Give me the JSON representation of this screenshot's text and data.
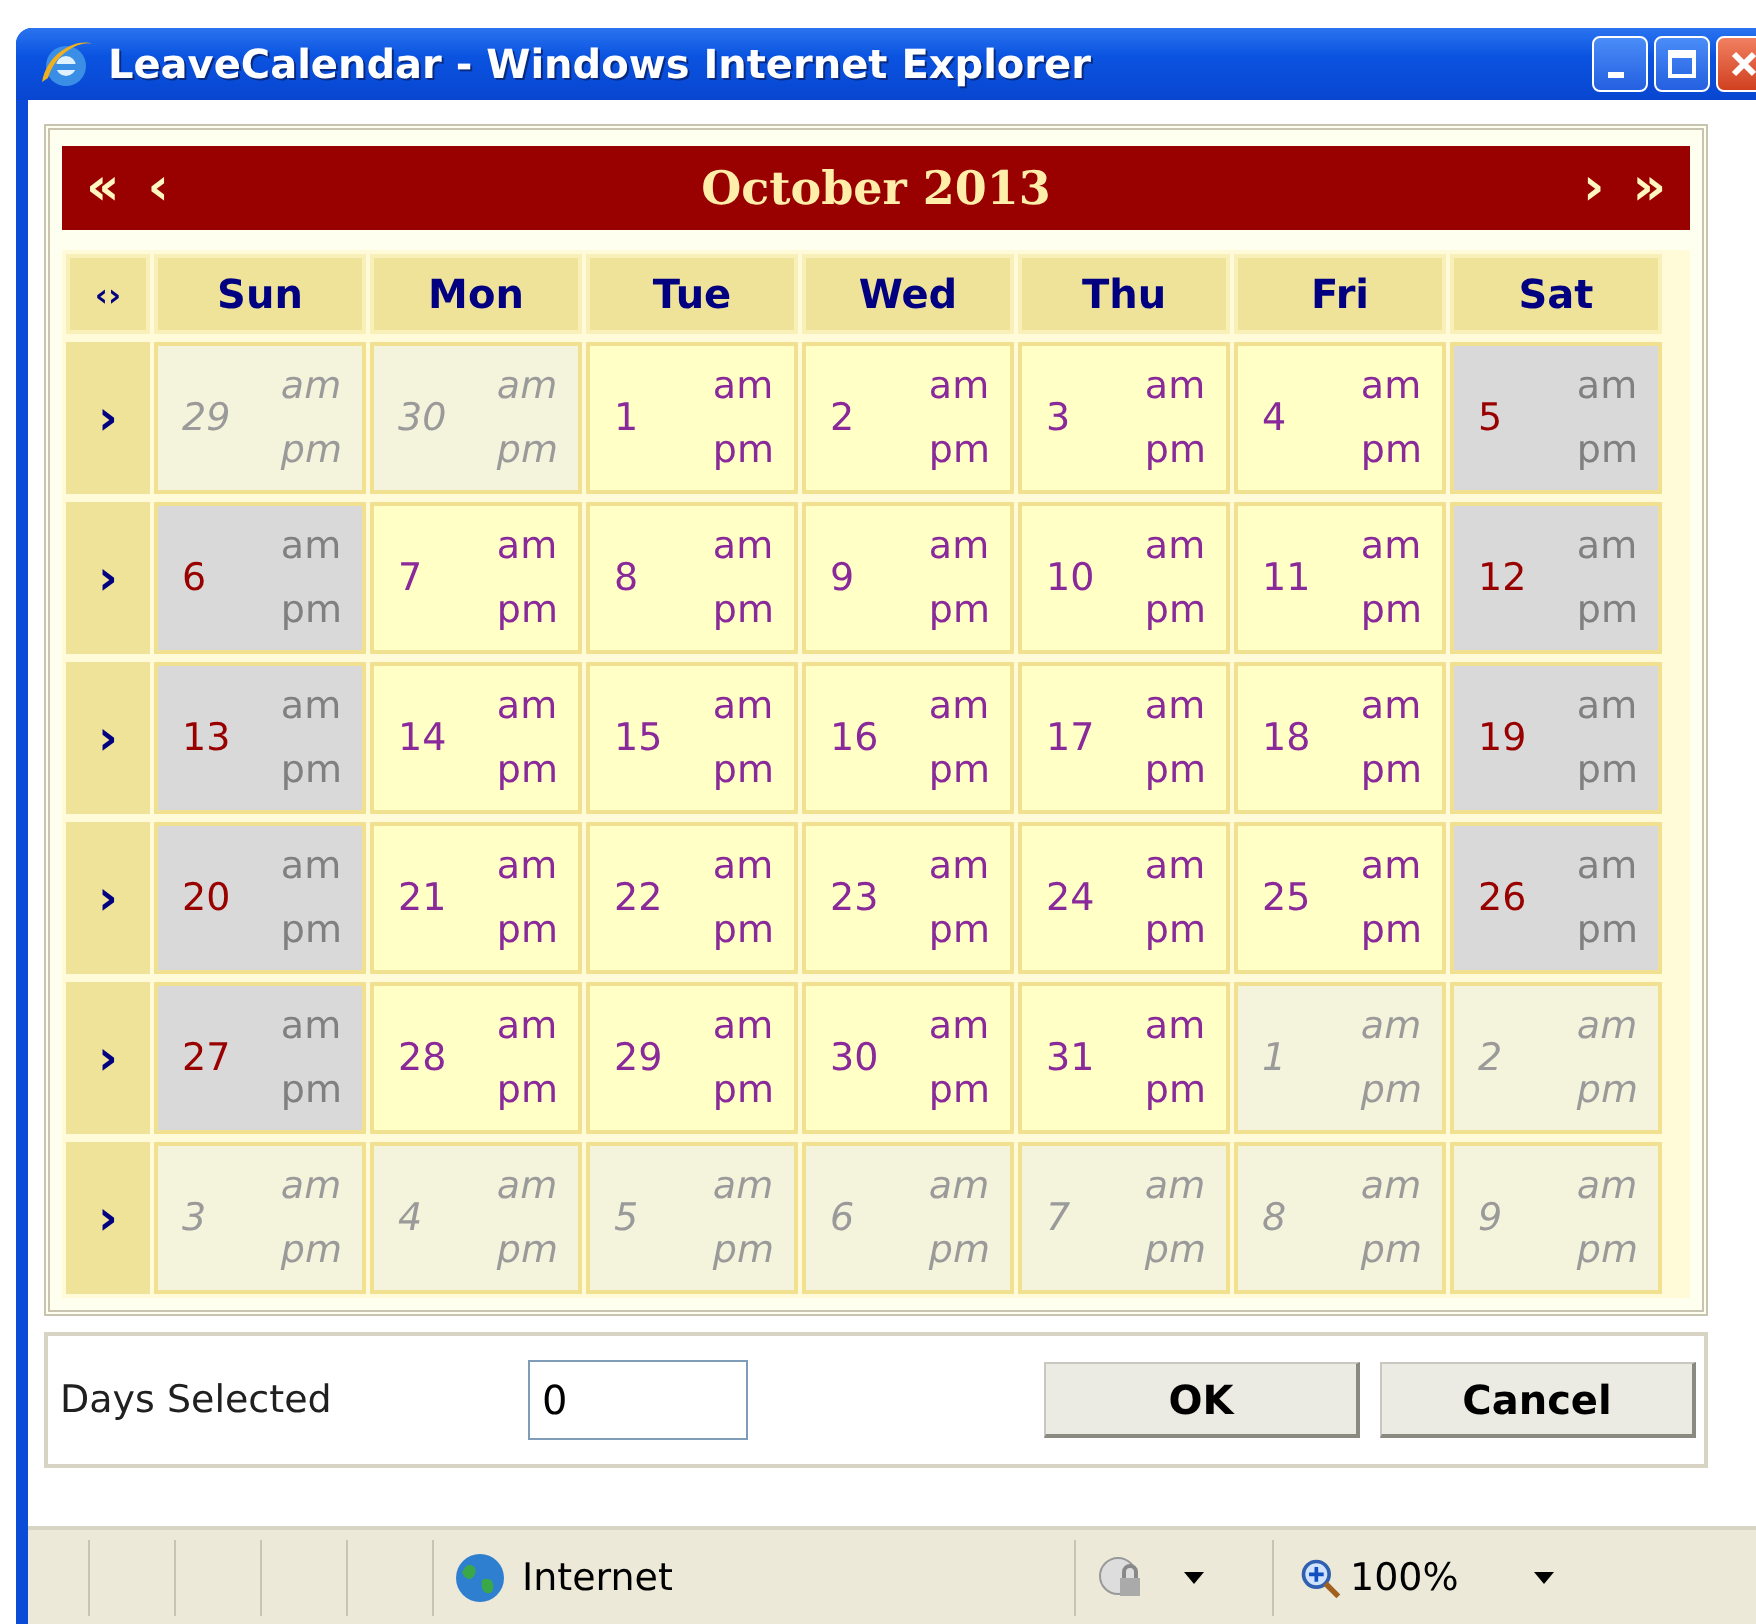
{
  "window": {
    "title": "LeaveCalendar - Windows Internet Explorer"
  },
  "calendar": {
    "nav_prev": [
      "«",
      "‹"
    ],
    "month": "October 2013",
    "nav_next": [
      "›",
      "»"
    ],
    "corner": "‹›",
    "weekdays": [
      "Sun",
      "Mon",
      "Tue",
      "Wed",
      "Thu",
      "Fri",
      "Sat"
    ],
    "weeks": [
      {
        "arrow": "›",
        "days": [
          {
            "day": "29",
            "kind": "other",
            "am": "am",
            "pm": "pm"
          },
          {
            "day": "30",
            "kind": "other",
            "am": "am",
            "pm": "pm"
          },
          {
            "day": "1",
            "kind": "weekday",
            "am": "am",
            "pm": "pm"
          },
          {
            "day": "2",
            "kind": "weekday",
            "am": "am",
            "pm": "pm"
          },
          {
            "day": "3",
            "kind": "weekday",
            "am": "am",
            "pm": "pm"
          },
          {
            "day": "4",
            "kind": "weekday",
            "am": "am",
            "pm": "pm"
          },
          {
            "day": "5",
            "kind": "weekend",
            "am": "am",
            "pm": "pm"
          }
        ]
      },
      {
        "arrow": "›",
        "days": [
          {
            "day": "6",
            "kind": "weekend",
            "am": "am",
            "pm": "pm"
          },
          {
            "day": "7",
            "kind": "weekday",
            "am": "am",
            "pm": "pm"
          },
          {
            "day": "8",
            "kind": "weekday",
            "am": "am",
            "pm": "pm"
          },
          {
            "day": "9",
            "kind": "weekday",
            "am": "am",
            "pm": "pm"
          },
          {
            "day": "10",
            "kind": "weekday",
            "am": "am",
            "pm": "pm"
          },
          {
            "day": "11",
            "kind": "weekday",
            "am": "am",
            "pm": "pm"
          },
          {
            "day": "12",
            "kind": "weekend",
            "am": "am",
            "pm": "pm"
          }
        ]
      },
      {
        "arrow": "›",
        "days": [
          {
            "day": "13",
            "kind": "weekend",
            "am": "am",
            "pm": "pm"
          },
          {
            "day": "14",
            "kind": "weekday",
            "am": "am",
            "pm": "pm"
          },
          {
            "day": "15",
            "kind": "weekday",
            "am": "am",
            "pm": "pm"
          },
          {
            "day": "16",
            "kind": "weekday",
            "am": "am",
            "pm": "pm"
          },
          {
            "day": "17",
            "kind": "weekday",
            "am": "am",
            "pm": "pm"
          },
          {
            "day": "18",
            "kind": "weekday",
            "am": "am",
            "pm": "pm"
          },
          {
            "day": "19",
            "kind": "weekend",
            "am": "am",
            "pm": "pm"
          }
        ]
      },
      {
        "arrow": "›",
        "days": [
          {
            "day": "20",
            "kind": "weekend",
            "am": "am",
            "pm": "pm"
          },
          {
            "day": "21",
            "kind": "weekday",
            "am": "am",
            "pm": "pm"
          },
          {
            "day": "22",
            "kind": "weekday",
            "am": "am",
            "pm": "pm"
          },
          {
            "day": "23",
            "kind": "weekday",
            "am": "am",
            "pm": "pm"
          },
          {
            "day": "24",
            "kind": "weekday",
            "am": "am",
            "pm": "pm"
          },
          {
            "day": "25",
            "kind": "weekday",
            "am": "am",
            "pm": "pm"
          },
          {
            "day": "26",
            "kind": "weekend",
            "am": "am",
            "pm": "pm"
          }
        ]
      },
      {
        "arrow": "›",
        "days": [
          {
            "day": "27",
            "kind": "weekend",
            "am": "am",
            "pm": "pm"
          },
          {
            "day": "28",
            "kind": "weekday",
            "am": "am",
            "pm": "pm"
          },
          {
            "day": "29",
            "kind": "weekday",
            "am": "am",
            "pm": "pm"
          },
          {
            "day": "30",
            "kind": "weekday",
            "am": "am",
            "pm": "pm"
          },
          {
            "day": "31",
            "kind": "weekday",
            "am": "am",
            "pm": "pm"
          },
          {
            "day": "1",
            "kind": "other",
            "am": "am",
            "pm": "pm"
          },
          {
            "day": "2",
            "kind": "other",
            "am": "am",
            "pm": "pm"
          }
        ]
      },
      {
        "arrow": "›",
        "days": [
          {
            "day": "3",
            "kind": "other",
            "am": "am",
            "pm": "pm"
          },
          {
            "day": "4",
            "kind": "other",
            "am": "am",
            "pm": "pm"
          },
          {
            "day": "5",
            "kind": "other",
            "am": "am",
            "pm": "pm"
          },
          {
            "day": "6",
            "kind": "other",
            "am": "am",
            "pm": "pm"
          },
          {
            "day": "7",
            "kind": "other",
            "am": "am",
            "pm": "pm"
          },
          {
            "day": "8",
            "kind": "other",
            "am": "am",
            "pm": "pm"
          },
          {
            "day": "9",
            "kind": "other",
            "am": "am",
            "pm": "pm"
          }
        ]
      }
    ]
  },
  "footer": {
    "label": "Days Selected",
    "value": "0",
    "buttons": [
      "OK",
      "Cancel"
    ]
  },
  "status_bar": {
    "zone": "Internet",
    "zoom": "100%"
  }
}
